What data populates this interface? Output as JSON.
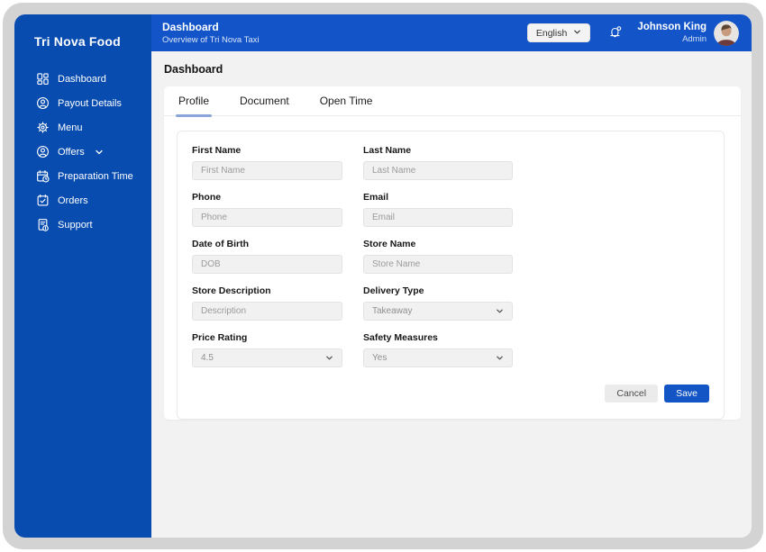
{
  "brand": "Tri Nova Food",
  "sidebar": {
    "items": [
      {
        "label": "Dashboard",
        "icon": "dashboard-grid-icon",
        "has_chevron": false
      },
      {
        "label": "Payout Details",
        "icon": "person-circle-icon",
        "has_chevron": false
      },
      {
        "label": "Menu",
        "icon": "gear-icon",
        "has_chevron": false
      },
      {
        "label": "Offers",
        "icon": "person-circle-icon",
        "has_chevron": true
      },
      {
        "label": "Preparation Time",
        "icon": "calendar-clock-icon",
        "has_chevron": false
      },
      {
        "label": "Orders",
        "icon": "calendar-check-icon",
        "has_chevron": false
      },
      {
        "label": "Support",
        "icon": "document-info-icon",
        "has_chevron": false
      }
    ]
  },
  "header": {
    "title": "Dashboard",
    "subtitle": "Overview of Tri Nova Taxi",
    "language": "English",
    "user": {
      "name": "Johnson King",
      "role": "Admin"
    }
  },
  "main": {
    "heading": "Dashboard",
    "tabs": [
      {
        "label": "Profile",
        "active": true
      },
      {
        "label": "Document",
        "active": false
      },
      {
        "label": "Open Time",
        "active": false
      }
    ],
    "form": {
      "fields": [
        {
          "label": "First Name",
          "type": "text",
          "placeholder": "First Name"
        },
        {
          "label": "Last Name",
          "type": "text",
          "placeholder": "Last Name"
        },
        {
          "label": "Phone",
          "type": "text",
          "placeholder": "Phone"
        },
        {
          "label": "Email",
          "type": "text",
          "placeholder": "Email"
        },
        {
          "label": "Date of Birth",
          "type": "text",
          "placeholder": "DOB"
        },
        {
          "label": "Store Name",
          "type": "text",
          "placeholder": "Store Name"
        },
        {
          "label": "Store Description",
          "type": "text",
          "placeholder": "Description"
        },
        {
          "label": "Delivery Type",
          "type": "select",
          "value": "Takeaway"
        },
        {
          "label": "Price Rating",
          "type": "select",
          "value": "4.5"
        },
        {
          "label": "Safety Measures",
          "type": "select",
          "value": "Yes"
        }
      ],
      "cancel_label": "Cancel",
      "save_label": "Save"
    }
  },
  "colors": {
    "sidebar_blue": "#084cb0",
    "header_blue": "#1355c9",
    "save_blue": "#1355c4",
    "tab_underline_blue": "#88a7d8",
    "frame_gray": "#d3d3d3",
    "content_bg": "#f2f2f3",
    "input_bg": "#f1f1f1"
  }
}
